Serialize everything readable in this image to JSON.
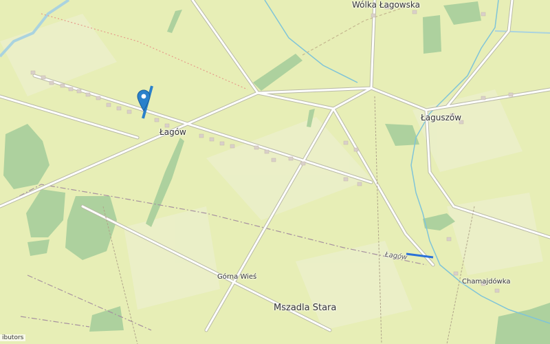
{
  "map": {
    "places": {
      "lagow": "Łagów",
      "wolka_lagowska": "Wólka Łagowska",
      "laguszow": "Łaguszów",
      "gorna_wies": "Górna Wieś",
      "mszadla_stara": "Mszadla Stara",
      "chamajdowka": "Chamajdówka",
      "road_label_lagow": "Łagów"
    },
    "attribution": "ibutors",
    "colors": {
      "background": "#e7eeb6",
      "forest": "#add19e",
      "field": "#eef0d5",
      "road": "#ffffff",
      "road_casing": "#b9b9a8",
      "water": "#aad3df",
      "river": "#7fc4d8",
      "marker": "#2a81cb",
      "highlight_path": "#2a70d8"
    },
    "marker_icon": "map-pin-icon"
  }
}
